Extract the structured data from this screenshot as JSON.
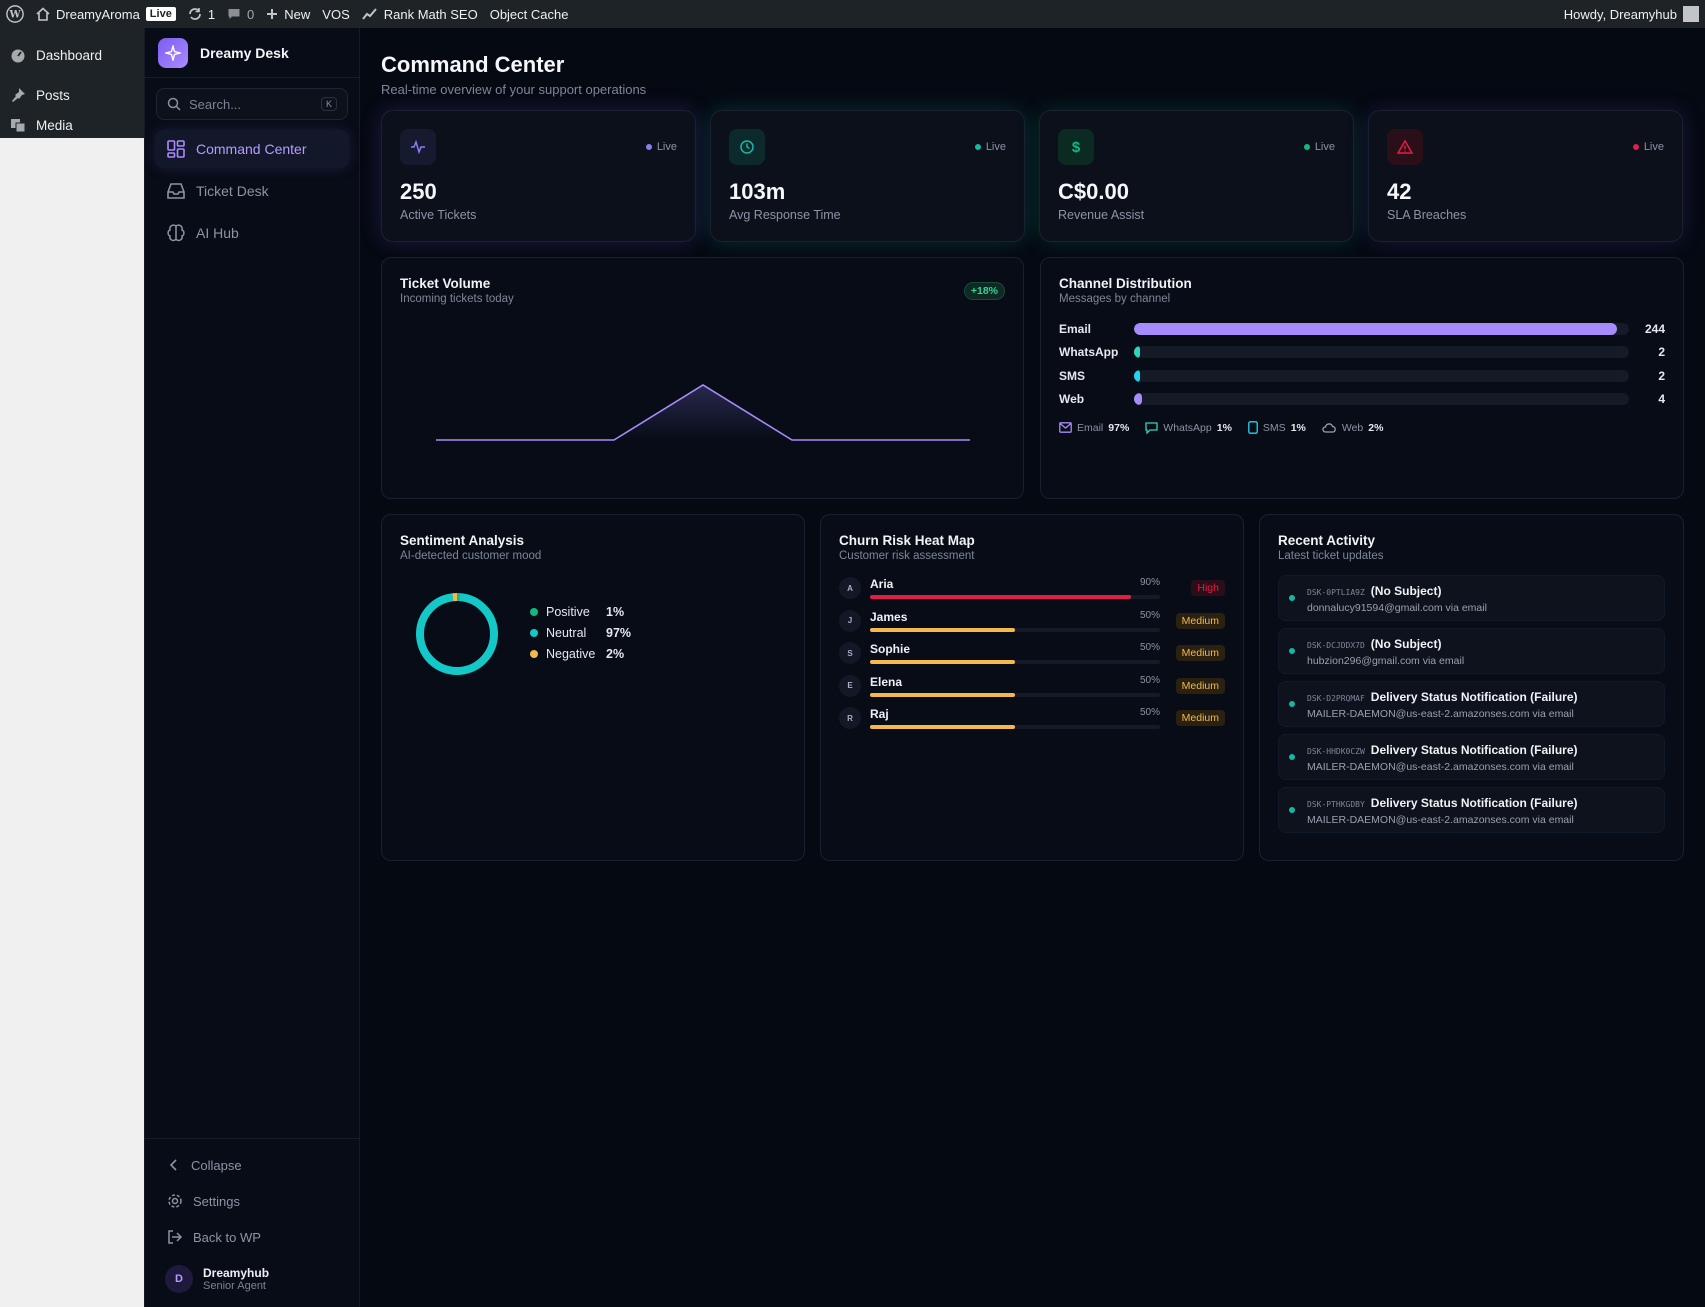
{
  "wpbar": {
    "site_name": "DreamyAroma",
    "live_badge": "Live",
    "updates_count": "1",
    "comments_count": "0",
    "new_label": "New",
    "vos_label": "VOS",
    "rankmath_label": "Rank Math SEO",
    "objectcache_label": "Object Cache",
    "howdy": "Howdy, Dreamyhub"
  },
  "wpmenu": {
    "items": [
      {
        "label": "Dashboard",
        "icon": "dashboard-icon"
      },
      {
        "label": "Posts",
        "icon": "pin-icon"
      },
      {
        "label": "Media",
        "icon": "media-icon"
      }
    ]
  },
  "sidebar": {
    "brand": "Dreamy Desk",
    "search_placeholder": "Search...",
    "search_shortcut": "K",
    "nav": [
      {
        "label": "Command Center",
        "icon": "dashboard-grid-icon",
        "active": true
      },
      {
        "label": "Ticket Desk",
        "icon": "inbox-icon",
        "active": false
      },
      {
        "label": "AI Hub",
        "icon": "brain-icon",
        "active": false
      }
    ],
    "bottom": {
      "collapse": "Collapse",
      "settings": "Settings",
      "back": "Back to WP"
    },
    "user": {
      "initial": "D",
      "name": "Dreamyhub",
      "role": "Senior Agent"
    }
  },
  "page": {
    "title": "Command Center",
    "subtitle": "Real-time overview of your support operations"
  },
  "stats": [
    {
      "value": "250",
      "label": "Active Tickets",
      "live": "Live",
      "icon": "activity-icon",
      "accent": "#8b7cf6"
    },
    {
      "value": "103m",
      "label": "Avg Response Time",
      "live": "Live",
      "icon": "clock-icon",
      "accent": "#14b8a6"
    },
    {
      "value": "C$0.00",
      "label": "Revenue Assist",
      "live": "Live",
      "icon": "dollar-icon",
      "accent": "#10b981"
    },
    {
      "value": "42",
      "label": "SLA Breaches",
      "live": "Live",
      "icon": "alert-triangle-icon",
      "accent": "#e11d48"
    }
  ],
  "ticket_volume": {
    "title": "Ticket Volume",
    "subtitle": "Incoming tickets today",
    "badge": "+18%"
  },
  "chart_data": {
    "type": "area",
    "x": [
      0,
      1,
      2,
      3,
      4,
      5,
      6
    ],
    "values": [
      0,
      0,
      0,
      1,
      0,
      0,
      0
    ],
    "title": "Ticket Volume",
    "subtitle": "Incoming tickets today",
    "ylim": [
      0,
      1
    ],
    "grid": false
  },
  "channels": {
    "title": "Channel Distribution",
    "subtitle": "Messages by channel",
    "max": 250,
    "rows": [
      {
        "name": "Email",
        "count": 244,
        "color": "#a78bfa"
      },
      {
        "name": "WhatsApp",
        "count": 2,
        "color": "#2dd4bf"
      },
      {
        "name": "SMS",
        "count": 2,
        "color": "#22d3ee"
      },
      {
        "name": "Web",
        "count": 4,
        "color": "#a78bfa"
      }
    ],
    "legend": [
      {
        "name": "Email",
        "pct": "97%",
        "icon": "mail-icon",
        "color": "#a78bfa"
      },
      {
        "name": "WhatsApp",
        "pct": "1%",
        "icon": "chat-icon",
        "color": "#2dd4bf"
      },
      {
        "name": "SMS",
        "pct": "1%",
        "icon": "phone-icon",
        "color": "#22d3ee"
      },
      {
        "name": "Web",
        "pct": "2%",
        "icon": "cloud-icon",
        "color": "#9aa0b0"
      }
    ]
  },
  "sentiment": {
    "title": "Sentiment Analysis",
    "subtitle": "AI-detected customer mood",
    "items": [
      {
        "name": "Positive",
        "pct": "1%",
        "value": 1,
        "color": "#10b981"
      },
      {
        "name": "Neutral",
        "pct": "97%",
        "value": 97,
        "color": "#14c8c8"
      },
      {
        "name": "Negative",
        "pct": "2%",
        "value": 2,
        "color": "#f5b84a"
      }
    ]
  },
  "churn": {
    "title": "Churn Risk Heat Map",
    "subtitle": "Customer risk assessment",
    "rows": [
      {
        "initial": "A",
        "name": "Aria",
        "pct": "90%",
        "value": 90,
        "risk": "High"
      },
      {
        "initial": "J",
        "name": "James",
        "pct": "50%",
        "value": 50,
        "risk": "Medium"
      },
      {
        "initial": "S",
        "name": "Sophie",
        "pct": "50%",
        "value": 50,
        "risk": "Medium"
      },
      {
        "initial": "E",
        "name": "Elena",
        "pct": "50%",
        "value": 50,
        "risk": "Medium"
      },
      {
        "initial": "R",
        "name": "Raj",
        "pct": "50%",
        "value": 50,
        "risk": "Medium"
      }
    ]
  },
  "activity": {
    "title": "Recent Activity",
    "subtitle": "Latest ticket updates",
    "items": [
      {
        "id": "DSK-0PTLIA9Z",
        "title": "(No Subject)",
        "sub": "donnalucy91594@gmail.com via email"
      },
      {
        "id": "DSK-DCJDDX7D",
        "title": "(No Subject)",
        "sub": "hubzion296@gmail.com via email"
      },
      {
        "id": "DSK-D2PRQMAF",
        "title": "Delivery Status Notification (Failure)",
        "sub": "MAILER-DAEMON@us-east-2.amazonses.com via email"
      },
      {
        "id": "DSK-HHDK0CZW",
        "title": "Delivery Status Notification (Failure)",
        "sub": "MAILER-DAEMON@us-east-2.amazonses.com via email"
      },
      {
        "id": "DSK-PTHKGDBY",
        "title": "Delivery Status Notification (Failure)",
        "sub": "MAILER-DAEMON@us-east-2.amazonses.com via email"
      }
    ]
  }
}
